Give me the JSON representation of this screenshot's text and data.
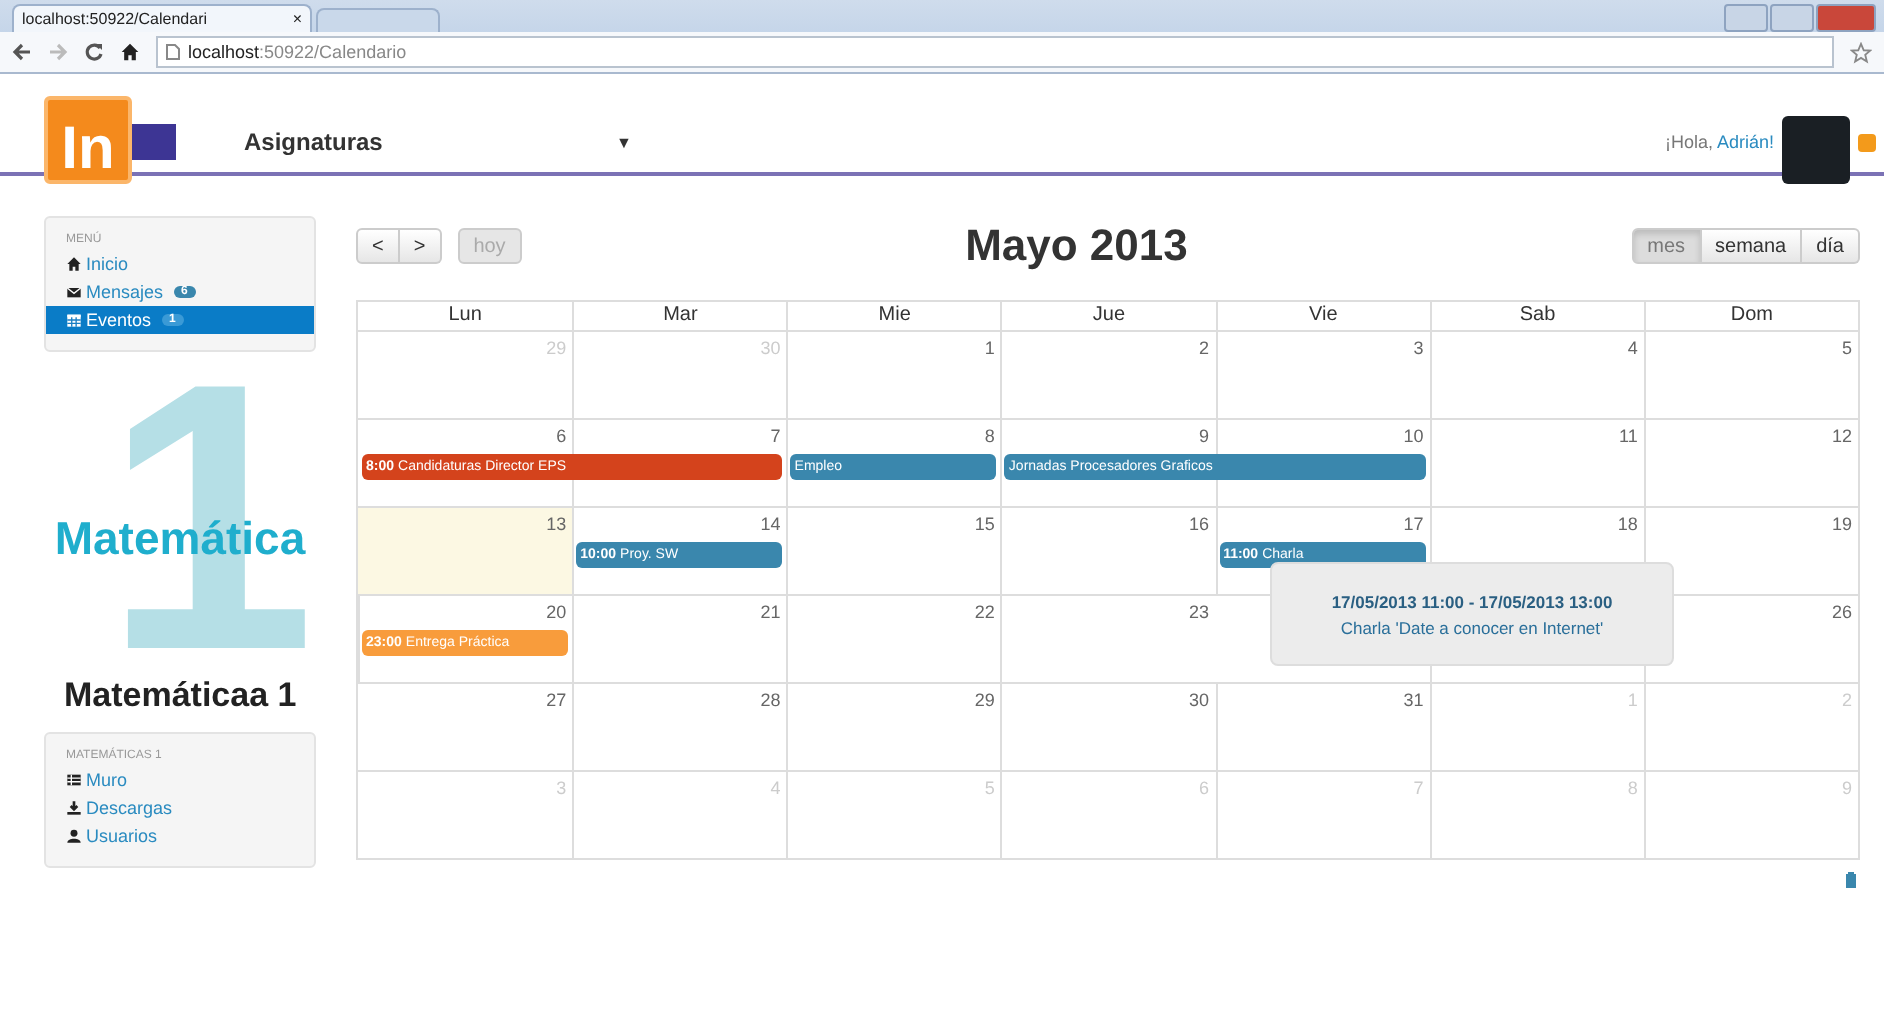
{
  "browser": {
    "tab_title": "localhost:50922/Calendari",
    "tab_close": "×",
    "url_host": "localhost",
    "url_path": ":50922/Calendario"
  },
  "navbar": {
    "logo": "In",
    "menu_label": "Asignaturas",
    "menu_caret": "▼",
    "greeting": "¡Hola, ",
    "user_name": "Adrián!"
  },
  "sidebar": {
    "menu_header": "MENÚ",
    "items": [
      {
        "label": "Inicio",
        "selected": false
      },
      {
        "label": "Mensajes",
        "badge": "6",
        "selected": false
      },
      {
        "label": "Eventos",
        "badge": "1",
        "selected": true
      }
    ],
    "course_image": {
      "numeral": "1",
      "caption": "Matemática"
    },
    "course_title": "Matemáticaa 1",
    "course_header": "MATEMÁTICAS 1",
    "course_items": [
      {
        "label": "Muro"
      },
      {
        "label": "Descargas"
      },
      {
        "label": "Usuarios"
      }
    ]
  },
  "calendar": {
    "prev": "<",
    "next": ">",
    "today_button": {
      "label": "hoy",
      "disabled": true
    },
    "title": "Mayo 2013",
    "views": [
      {
        "label": "mes",
        "selected": true
      },
      {
        "label": "semana",
        "selected": false
      },
      {
        "label": "día",
        "selected": false
      }
    ],
    "weekdays": [
      "Lun",
      "Mar",
      "Mie",
      "Jue",
      "Vie",
      "Sab",
      "Dom"
    ],
    "weeks": [
      {
        "days": [
          {
            "n": "29",
            "muted": true,
            "today": false
          },
          {
            "n": "30",
            "muted": true,
            "today": false
          },
          {
            "n": "1",
            "muted": false,
            "today": false
          },
          {
            "n": "2",
            "muted": false,
            "today": false
          },
          {
            "n": "3",
            "muted": false,
            "today": false
          },
          {
            "n": "4",
            "muted": false,
            "today": false
          },
          {
            "n": "5",
            "muted": false,
            "today": false
          }
        ]
      },
      {
        "days": [
          {
            "n": "6",
            "muted": false,
            "today": false,
            "events": [
              {
                "time": "8:00",
                "title": "Candidaturas Director EPS",
                "color": "#d4431c"
              }
            ]
          },
          {
            "n": "7",
            "muted": false,
            "today": false
          },
          {
            "n": "8",
            "muted": false,
            "today": false,
            "events": [
              {
                "title": "Empleo",
                "color": "#3a87ad"
              }
            ]
          },
          {
            "n": "9",
            "muted": false,
            "today": false,
            "events": [
              {
                "title": "Jornadas Procesadores Graficos",
                "color": "#3a87ad"
              }
            ]
          },
          {
            "n": "10",
            "muted": false,
            "today": false
          },
          {
            "n": "11",
            "muted": false,
            "today": false
          },
          {
            "n": "12",
            "muted": false,
            "today": false
          }
        ]
      },
      {
        "days": [
          {
            "n": "13",
            "muted": false,
            "today": true
          },
          {
            "n": "14",
            "muted": false,
            "today": false,
            "events": [
              {
                "time": "10:00",
                "title": "Proy. SW",
                "color": "#3a87ad"
              }
            ]
          },
          {
            "n": "15",
            "muted": false,
            "today": false
          },
          {
            "n": "16",
            "muted": false,
            "today": false
          },
          {
            "n": "17",
            "muted": false,
            "today": false,
            "events": [
              {
                "time": "11:00",
                "title": "Charla",
                "color": "#3a87ad"
              }
            ]
          },
          {
            "n": "18",
            "muted": false,
            "today": false
          },
          {
            "n": "19",
            "muted": false,
            "today": false
          }
        ]
      },
      {
        "days": [
          {
            "n": "20",
            "muted": false,
            "today": false,
            "events": [
              {
                "time": "23:00",
                "title": "Entrega Práctica",
                "color": "#f89c3c"
              }
            ]
          },
          {
            "n": "21",
            "muted": false,
            "today": false
          },
          {
            "n": "22",
            "muted": false,
            "today": false
          },
          {
            "n": "23",
            "muted": false,
            "today": false
          },
          {
            "n": "26",
            "muted": false,
            "today": false
          }
        ]
      },
      {
        "days": [
          {
            "n": "27",
            "muted": false,
            "today": false
          },
          {
            "n": "28",
            "muted": false,
            "today": false
          },
          {
            "n": "29",
            "muted": false,
            "today": false
          },
          {
            "n": "30",
            "muted": false,
            "today": false
          },
          {
            "n": "31",
            "muted": false,
            "today": false
          },
          {
            "n": "1",
            "muted": true,
            "today": false
          },
          {
            "n": "2",
            "muted": true,
            "today": false
          }
        ]
      },
      {
        "days": [
          {
            "n": "3",
            "muted": true,
            "today": false
          },
          {
            "n": "4",
            "muted": true,
            "today": false
          },
          {
            "n": "5",
            "muted": true,
            "today": false
          },
          {
            "n": "6",
            "muted": true,
            "today": false
          },
          {
            "n": "7",
            "muted": true,
            "today": false
          },
          {
            "n": "8",
            "muted": true,
            "today": false
          },
          {
            "n": "9",
            "muted": true,
            "today": false
          }
        ]
      }
    ],
    "tooltip": {
      "dates": "17/05/2013 11:00 - 17/05/2013 13:00",
      "text": "Charla 'Date a conocer en Internet'"
    }
  }
}
